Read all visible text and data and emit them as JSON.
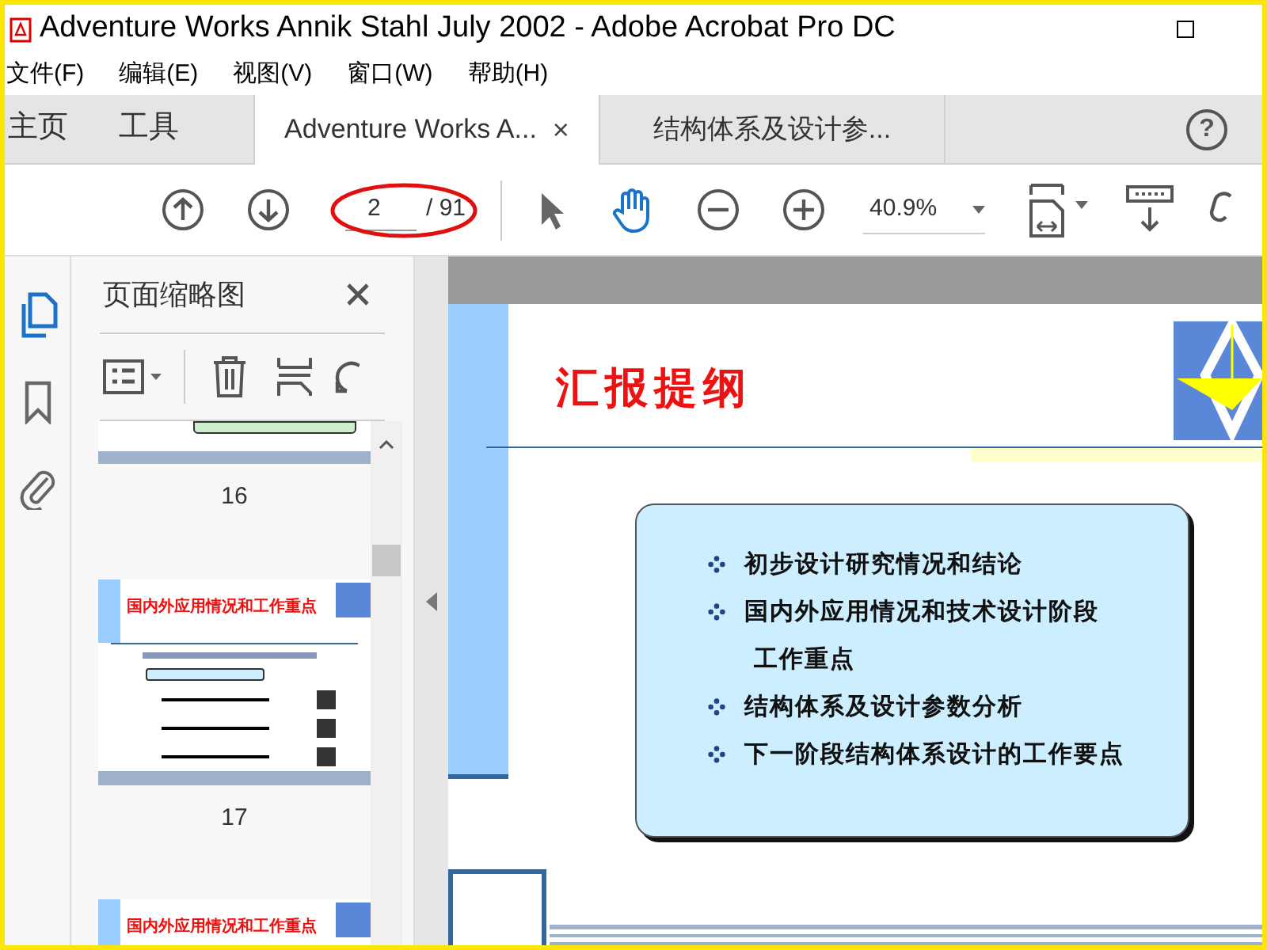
{
  "window": {
    "title": "Adventure Works Annik Stahl July 2002 - Adobe Acrobat Pro DC"
  },
  "menu": [
    "文件(F)",
    "编辑(E)",
    "视图(V)",
    "窗口(W)",
    "帮助(H)"
  ],
  "nav_tabs": [
    "主页",
    "工具"
  ],
  "doc_tabs": [
    {
      "label": "Adventure Works A...",
      "selected": true,
      "close": "×"
    },
    {
      "label": "结构体系及设计参...",
      "selected": false
    }
  ],
  "help": "?",
  "toolbar": {
    "page_number": "2",
    "page_count": "/ 91",
    "zoom": "40.9%"
  },
  "thumbnail_panel": {
    "title": "页面缩略图",
    "thumbnails": [
      {
        "label": "16",
        "kind": "partial"
      },
      {
        "label": "17",
        "kind": "full",
        "title": "国内外应用情况和工作重点"
      },
      {
        "kind": "partial_bottom",
        "title": "国内外应用情况和工作重点"
      }
    ]
  },
  "slide": {
    "title": "汇报提纲",
    "items": [
      {
        "text": "初步设计研究情况和结论",
        "indent": false
      },
      {
        "text": "国内外应用情况和技术设计阶段",
        "indent": false
      },
      {
        "text": "工作重点",
        "indent": true
      },
      {
        "text": "结构体系及设计参数分析",
        "indent": false
      },
      {
        "text": "下一阶段结构体系设计的工作要点",
        "indent": false
      }
    ]
  }
}
